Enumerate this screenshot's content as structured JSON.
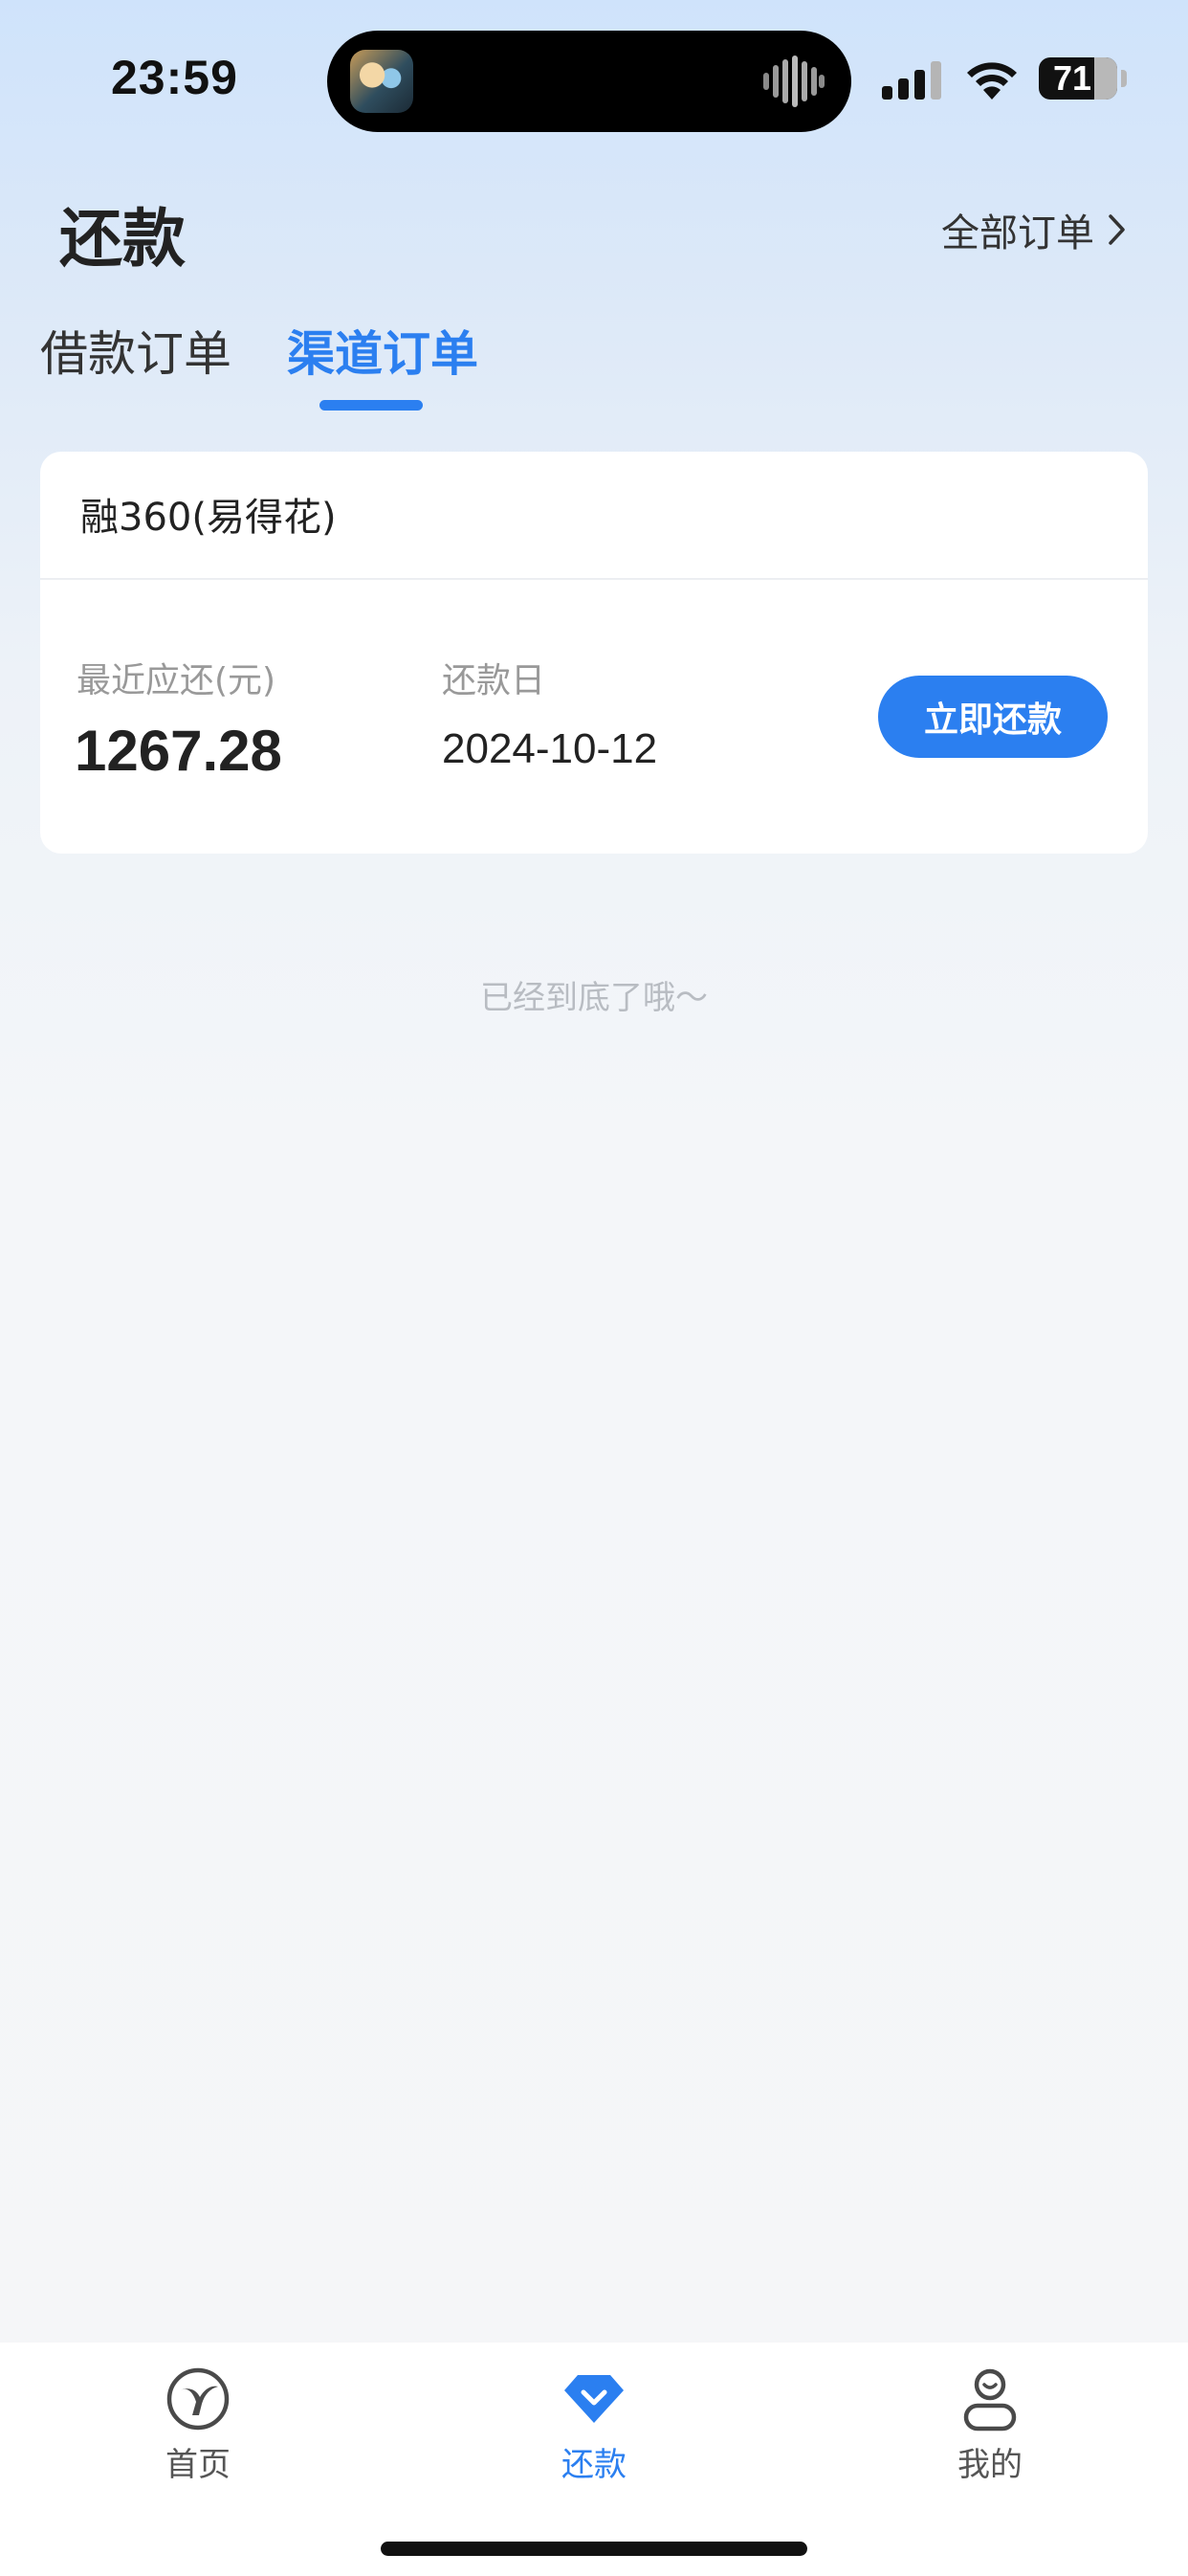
{
  "status_bar": {
    "time": "23:59",
    "battery": "71",
    "battery_level": 0.71
  },
  "header": {
    "title": "还款",
    "all_orders_label": "全部订单"
  },
  "tabs": [
    {
      "label": "借款订单",
      "active": false
    },
    {
      "label": "渠道订单",
      "active": true
    }
  ],
  "order_card": {
    "title": "融360(易得花)",
    "amount_label": "最近应还(元)",
    "amount": "1267.28",
    "date_label": "还款日",
    "date": "2024-10-12",
    "button_label": "立即还款"
  },
  "list_end_hint": "已经到底了哦～",
  "tab_bar": {
    "items": [
      {
        "label": "首页",
        "icon": "home-logo-icon",
        "active": false
      },
      {
        "label": "还款",
        "icon": "repay-diamond-icon",
        "active": true
      },
      {
        "label": "我的",
        "icon": "profile-icon",
        "active": false
      }
    ]
  },
  "colors": {
    "accent": "#2b7ff0",
    "background_top": "#cfe3fb",
    "background": "#f5f6f8",
    "text_primary": "#222222",
    "text_secondary": "#999999"
  }
}
